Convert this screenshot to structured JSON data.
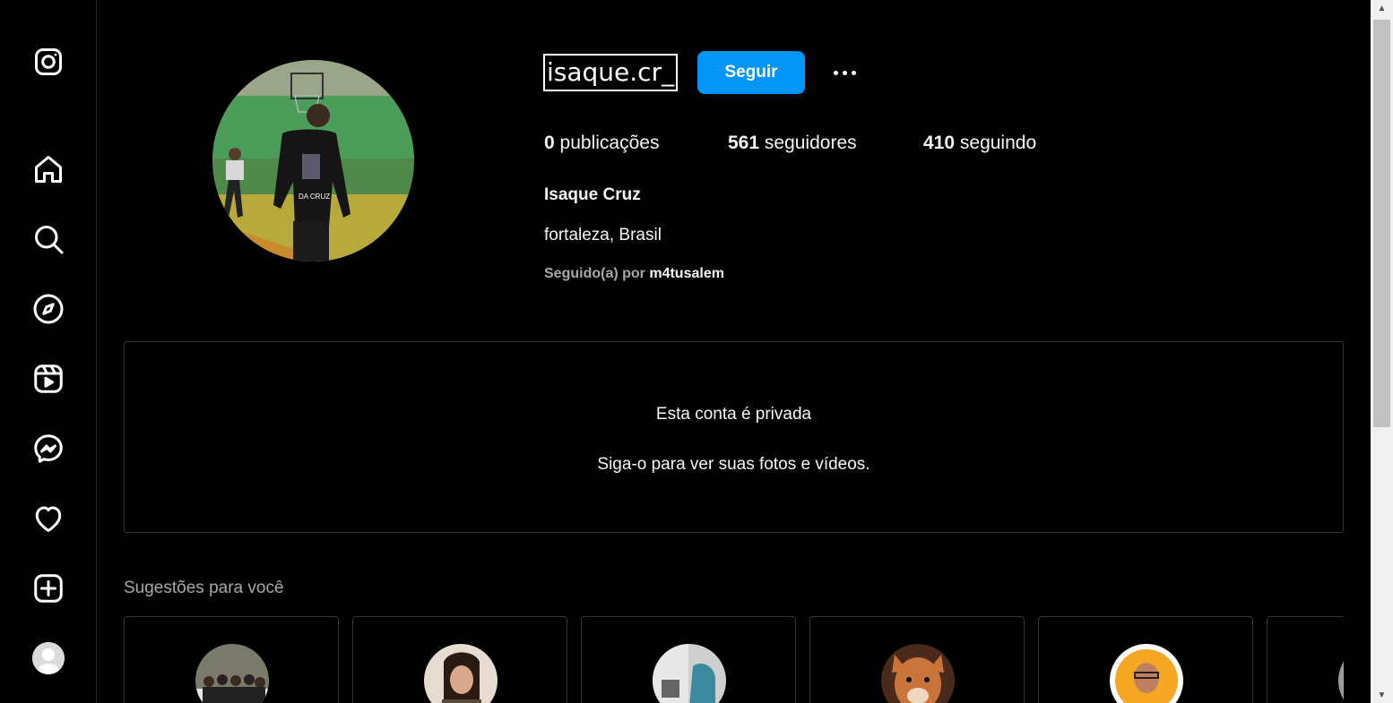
{
  "sidebar": {
    "items": [
      {
        "name": "instagram-logo-icon"
      },
      {
        "name": "home-icon"
      },
      {
        "name": "search-icon"
      },
      {
        "name": "explore-icon"
      },
      {
        "name": "reels-icon"
      },
      {
        "name": "messenger-icon"
      },
      {
        "name": "heart-icon"
      },
      {
        "name": "create-icon"
      }
    ]
  },
  "profile": {
    "username": "isaque.cr_",
    "follow_label": "Seguir",
    "stats": {
      "posts_count": "0",
      "posts_label": "publicações",
      "followers_count": "561",
      "followers_label": "seguidores",
      "following_count": "410",
      "following_label": "seguindo"
    },
    "full_name": "Isaque Cruz",
    "bio": "fortaleza, Brasil",
    "followed_by_prefix": "Seguido(a) por",
    "followed_by_user": "m4tusalem"
  },
  "private": {
    "title": "Esta conta é privada",
    "subtitle": "Siga-o para ver suas fotos e vídeos."
  },
  "suggestions": {
    "title": "Sugestões para você"
  },
  "colors": {
    "accent": "#0095f6",
    "background": "#000000",
    "border": "#363636",
    "secondary_text": "#a8a8a8"
  }
}
